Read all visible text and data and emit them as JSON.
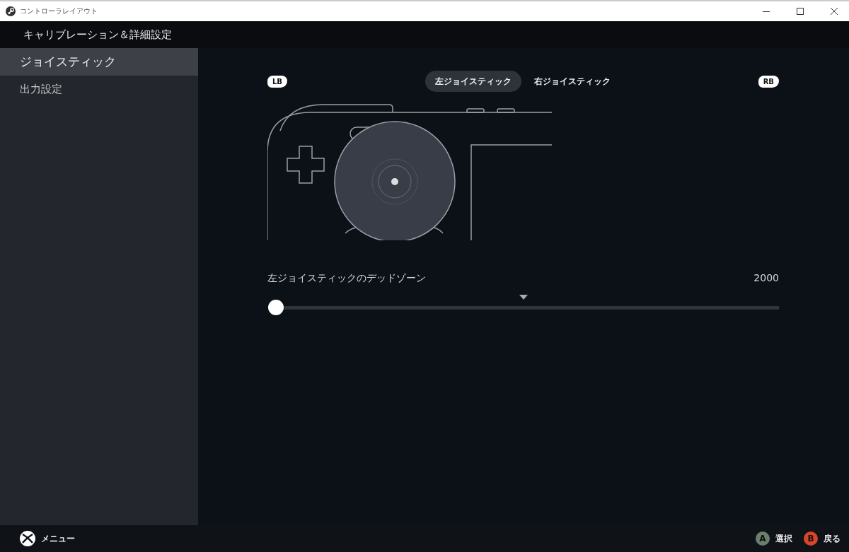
{
  "window": {
    "title": "コントローラレイアウト"
  },
  "header": {
    "title": "キャリブレーション＆詳細設定"
  },
  "sidebar": {
    "items": [
      {
        "label": "ジョイスティック",
        "selected": true
      },
      {
        "label": "出力設定",
        "selected": false
      }
    ]
  },
  "bumpers": {
    "left": "LB",
    "right": "RB"
  },
  "tabs": [
    {
      "label": "左ジョイスティック",
      "selected": true
    },
    {
      "label": "右ジョイスティック",
      "selected": false
    }
  ],
  "deadzone": {
    "label": "左ジョイスティックのデッドゾーン",
    "reading": "2000",
    "level": 0
  },
  "footer": {
    "menu": "メニュー",
    "actions": [
      {
        "key": "A",
        "label": "選択",
        "color": "#6b7f6e"
      },
      {
        "key": "B",
        "label": "戻る",
        "color": "#d9452b"
      }
    ]
  }
}
